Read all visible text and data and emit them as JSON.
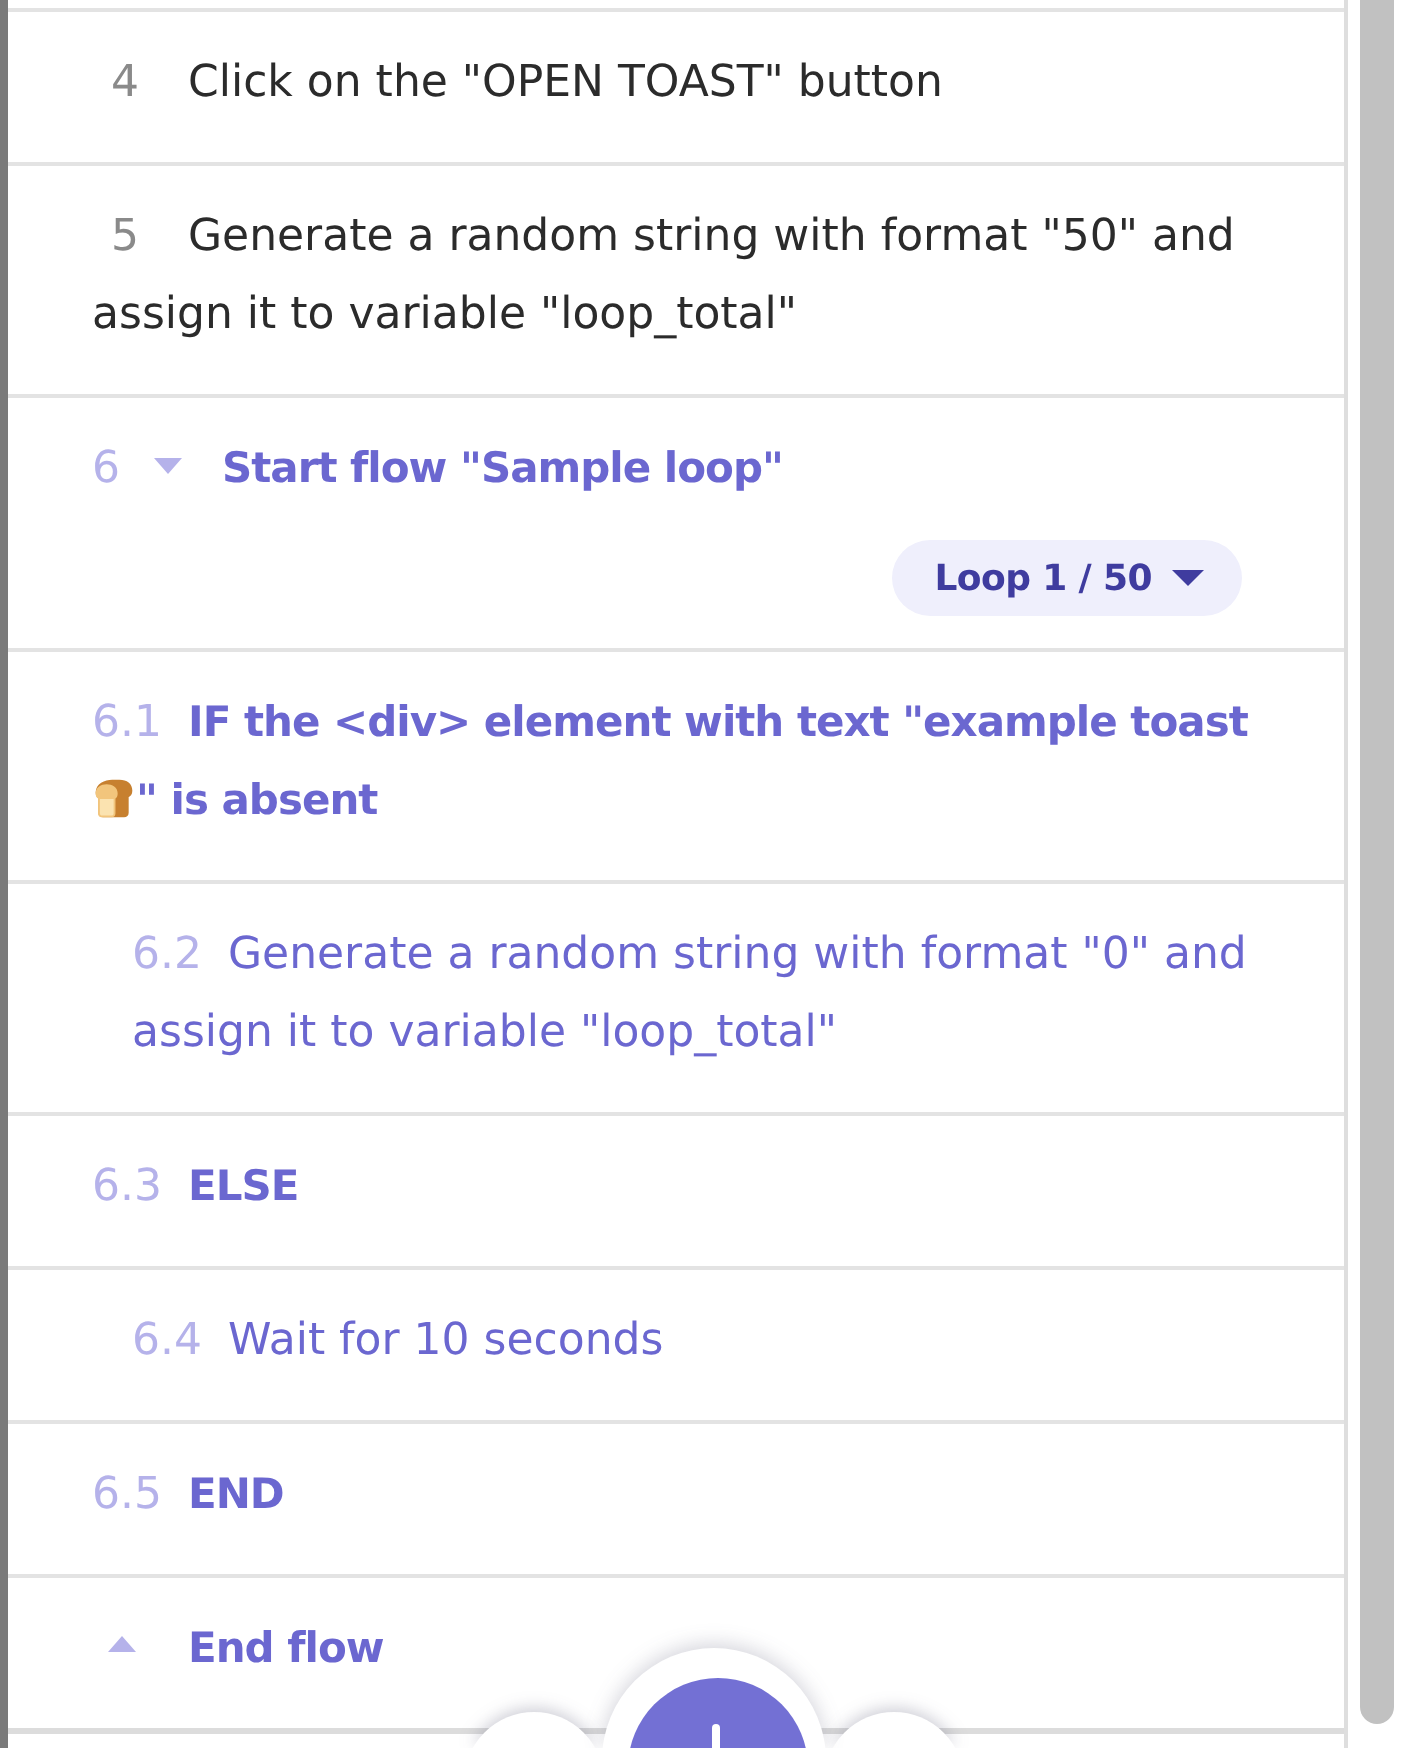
{
  "steps": [
    {
      "kind": "action",
      "number": "4",
      "text": "Click on the \"OPEN TOAST\" button"
    },
    {
      "kind": "action",
      "number": "5",
      "text": "Generate a random string with format \"50\" and assign it to variable \"loop_total\""
    },
    {
      "kind": "flow_start",
      "number": "6",
      "text": "Start flow \"Sample loop\"",
      "expanded": true,
      "loop_selector": {
        "label": "Loop 1 / 50"
      },
      "children": [
        {
          "kind": "control",
          "number": "6.1",
          "text": "IF the <div> element with text \"example toast",
          "text_after_icon": "\" is absent",
          "children": [
            {
              "kind": "action",
              "number": "6.2",
              "text": "Generate a random string with format \"0\" and assign it to variable \"loop_total\""
            }
          ]
        },
        {
          "kind": "control",
          "number": "6.3",
          "text": "ELSE",
          "children": [
            {
              "kind": "action",
              "number": "6.4",
              "text": "Wait for 10 seconds"
            }
          ]
        },
        {
          "kind": "control",
          "number": "6.5",
          "text": "END"
        }
      ]
    },
    {
      "kind": "flow_end",
      "text": "End flow"
    }
  ]
}
